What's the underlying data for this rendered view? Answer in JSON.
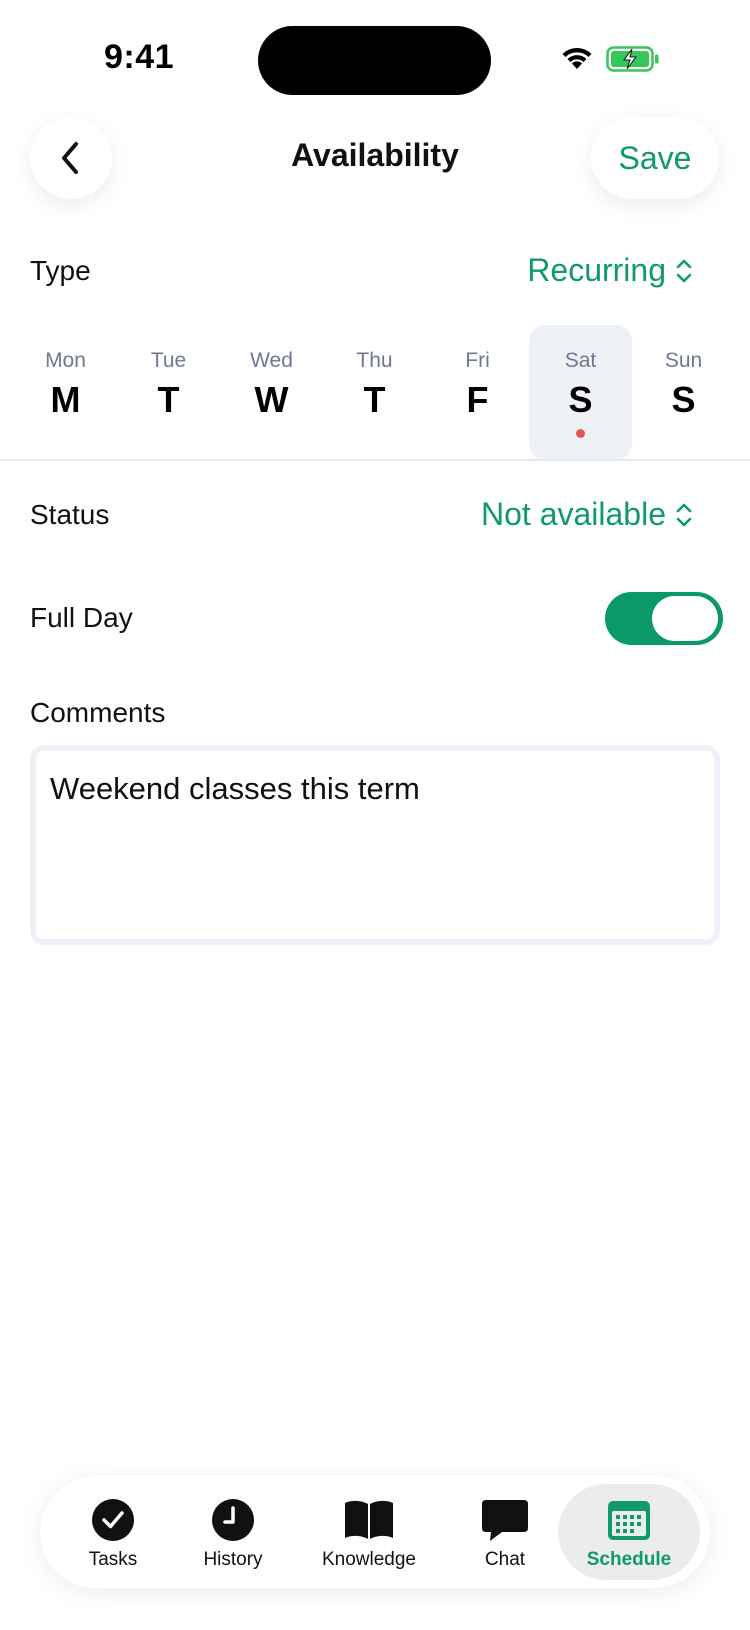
{
  "status_bar": {
    "time": "9:41"
  },
  "header": {
    "title": "Availability",
    "save_label": "Save"
  },
  "type_row": {
    "label": "Type",
    "value": "Recurring"
  },
  "days": [
    {
      "short": "Mon",
      "letter": "M",
      "selected": false,
      "has_dot": false
    },
    {
      "short": "Tue",
      "letter": "T",
      "selected": false,
      "has_dot": false
    },
    {
      "short": "Wed",
      "letter": "W",
      "selected": false,
      "has_dot": false
    },
    {
      "short": "Thu",
      "letter": "T",
      "selected": false,
      "has_dot": false
    },
    {
      "short": "Fri",
      "letter": "F",
      "selected": false,
      "has_dot": false
    },
    {
      "short": "Sat",
      "letter": "S",
      "selected": true,
      "has_dot": true
    },
    {
      "short": "Sun",
      "letter": "S",
      "selected": false,
      "has_dot": false
    }
  ],
  "status_row": {
    "label": "Status",
    "value": "Not available"
  },
  "full_day_row": {
    "label": "Full Day",
    "toggle_on": true
  },
  "comments": {
    "label": "Comments",
    "value": "Weekend classes this term"
  },
  "tab_bar": {
    "tabs": [
      {
        "label": "Tasks",
        "icon": "check-circle-icon",
        "active": false
      },
      {
        "label": "History",
        "icon": "clock-icon",
        "active": false
      },
      {
        "label": "Knowledge",
        "icon": "book-icon",
        "active": false
      },
      {
        "label": "Chat",
        "icon": "chat-bubble-icon",
        "active": false
      },
      {
        "label": "Schedule",
        "icon": "calendar-icon",
        "active": true
      }
    ]
  },
  "colors": {
    "accent": "#0f9a67",
    "toggle_on": "#0a9a68",
    "dot": "#e25656",
    "selected_day_bg": "#eef2f7"
  }
}
